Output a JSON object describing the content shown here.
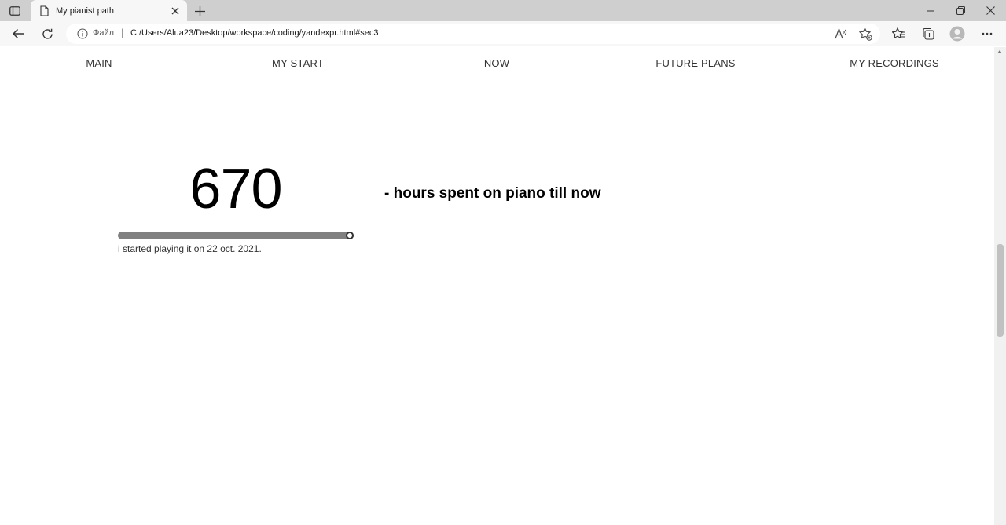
{
  "browser": {
    "tab_title": "My pianist path",
    "address_protocol": "Файл",
    "address_separator": "|",
    "address_url": "C:/Users/Alua23/Desktop/workspace/coding/yandexpr.html#sec3"
  },
  "nav": {
    "items": [
      {
        "label": "MAIN"
      },
      {
        "label": "MY START"
      },
      {
        "label": "NOW"
      },
      {
        "label": "FUTURE PLANS"
      },
      {
        "label": "MY RECORDINGS"
      }
    ]
  },
  "stats": {
    "hours": "670",
    "caption": "- hours spent on piano till now",
    "progress_fraction": 1.0,
    "start_note": "i started playing it on 22 oct. 2021."
  },
  "colors": {
    "progress_fill": "#808080",
    "knob_border": "#333333",
    "tabstrip": "#cfcfcf"
  }
}
